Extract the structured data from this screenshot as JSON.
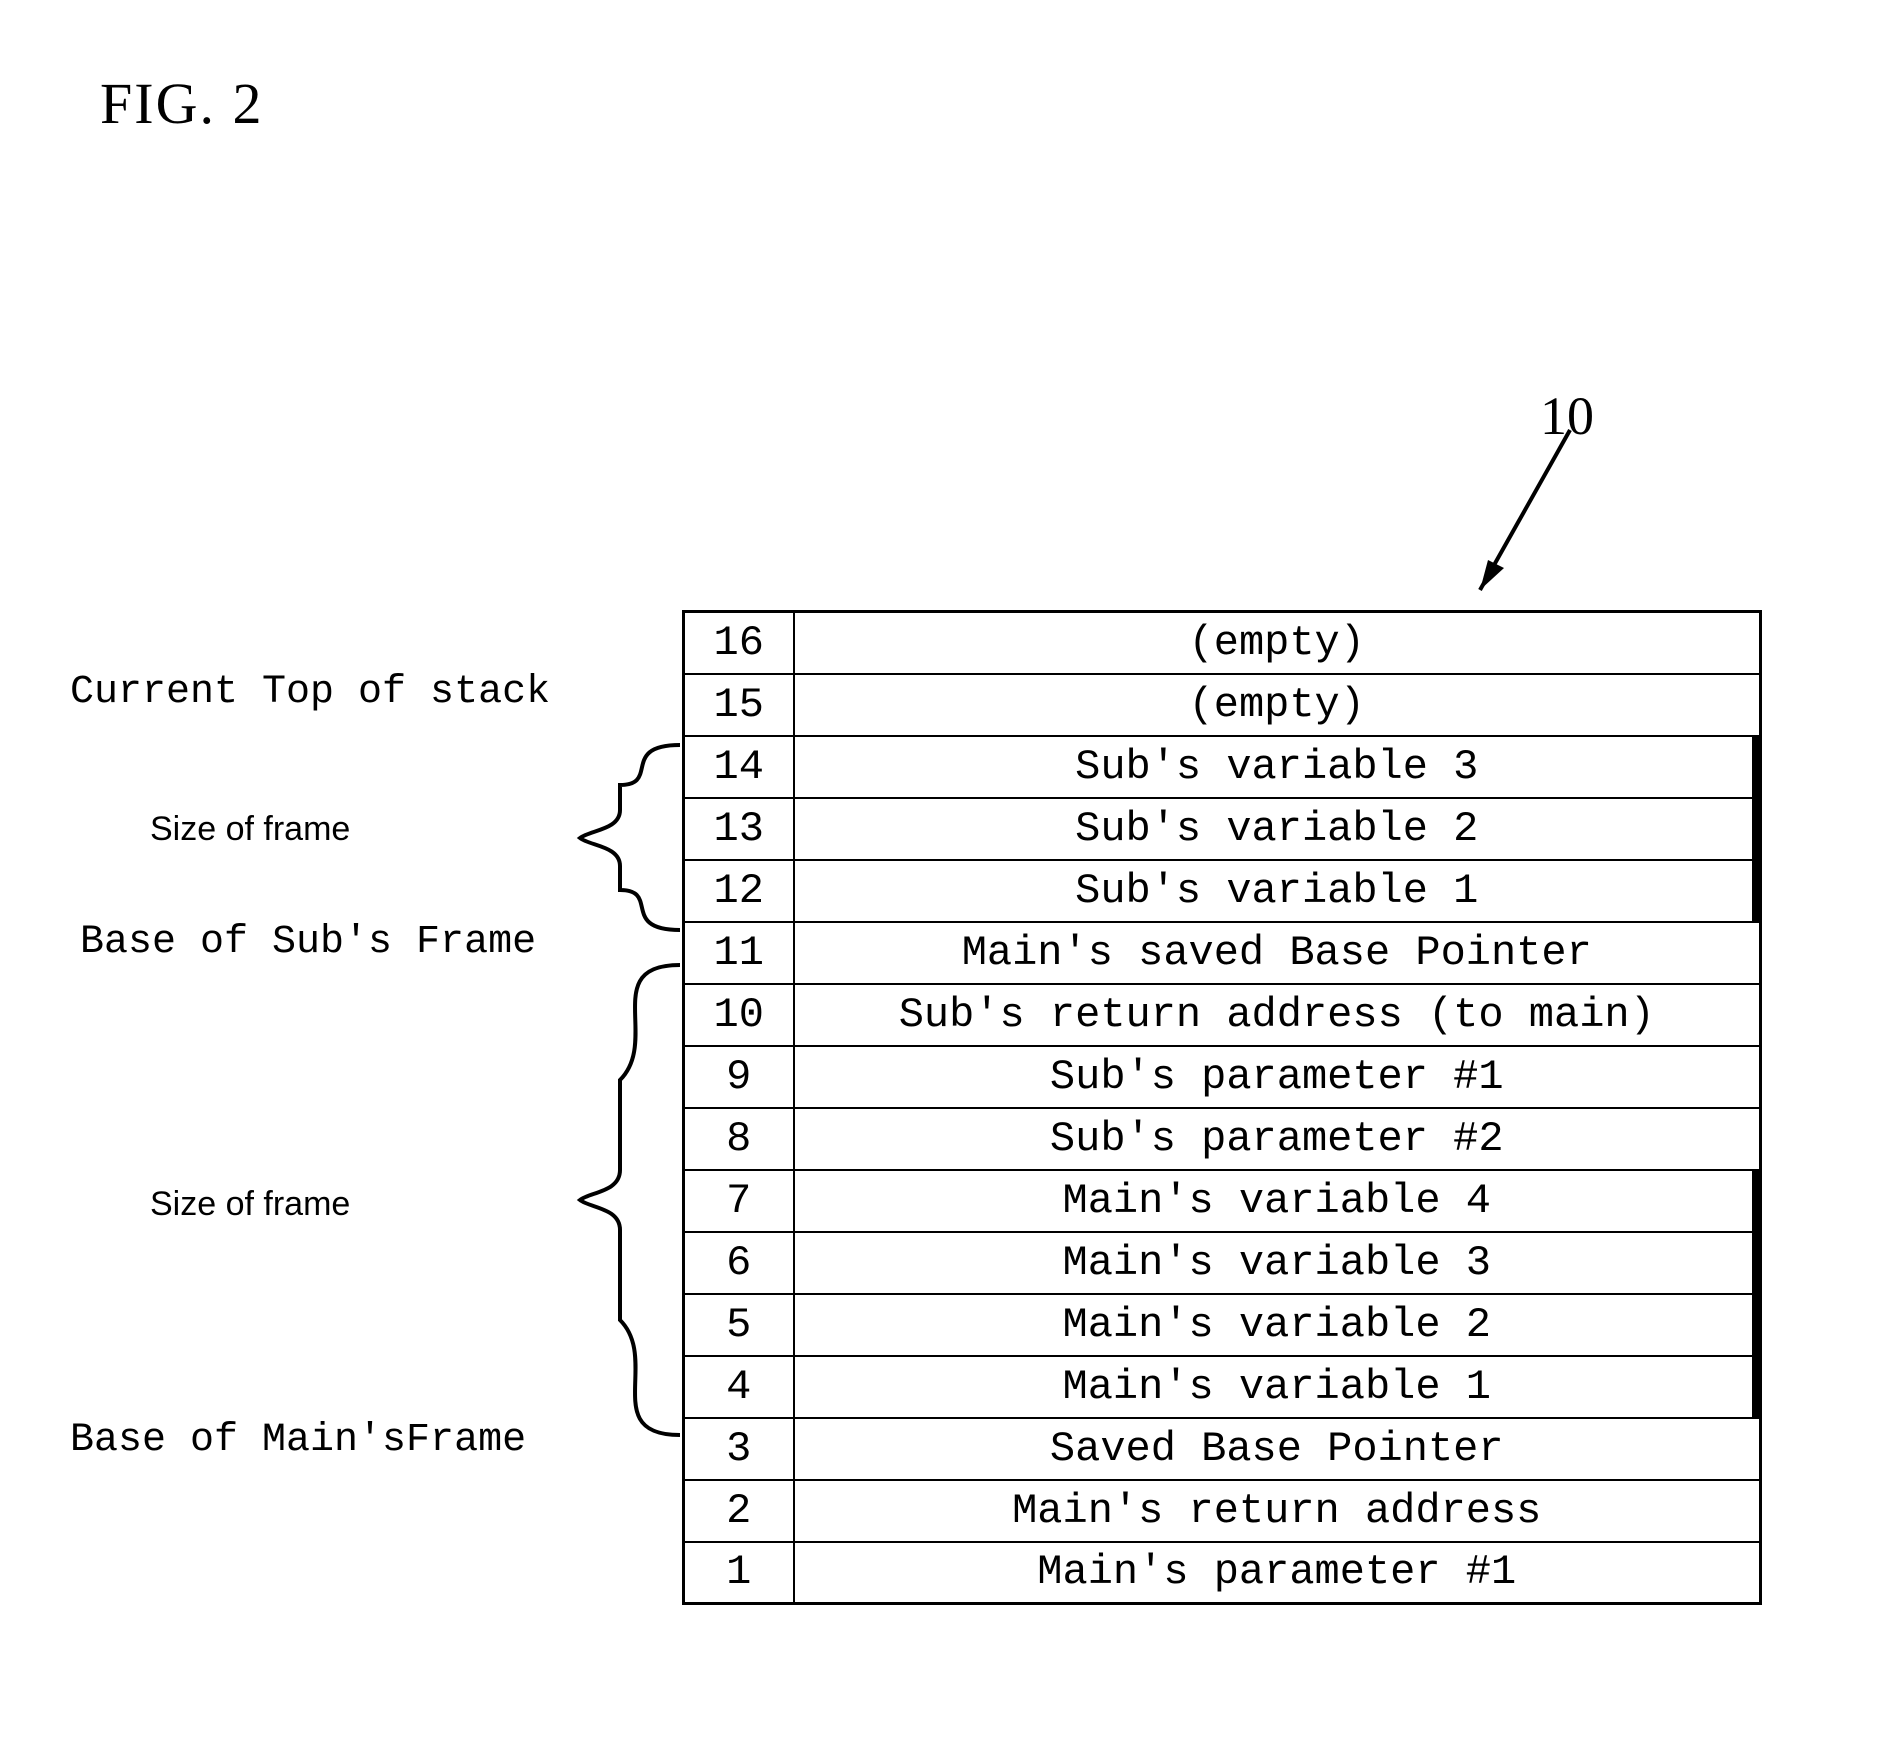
{
  "figure_title": "FIG. 2",
  "reference_number": "10",
  "labels": {
    "top_of_stack": "Current Top of stack",
    "size_of_frame_upper": "Size of frame",
    "base_sub": "Base of Sub's Frame",
    "size_of_frame_lower": "Size of frame",
    "base_main": "Base of Main'sFrame"
  },
  "rows": [
    {
      "addr": "16",
      "desc": "(empty)",
      "thick": false
    },
    {
      "addr": "15",
      "desc": "(empty)",
      "thick": false
    },
    {
      "addr": "14",
      "desc": "Sub's variable 3",
      "thick": true
    },
    {
      "addr": "13",
      "desc": "Sub's variable 2",
      "thick": true
    },
    {
      "addr": "12",
      "desc": "Sub's variable 1",
      "thick": true
    },
    {
      "addr": "11",
      "desc": "Main's saved Base Pointer",
      "thick": false
    },
    {
      "addr": "10",
      "desc": "Sub's return address (to main)",
      "thick": false
    },
    {
      "addr": "9",
      "desc": "Sub's parameter #1",
      "thick": false
    },
    {
      "addr": "8",
      "desc": "Sub's parameter #2",
      "thick": false
    },
    {
      "addr": "7",
      "desc": "Main's variable 4",
      "thick": true
    },
    {
      "addr": "6",
      "desc": "Main's variable 3",
      "thick": true
    },
    {
      "addr": "5",
      "desc": "Main's variable 2",
      "thick": true
    },
    {
      "addr": "4",
      "desc": "Main's variable 1",
      "thick": true
    },
    {
      "addr": "3",
      "desc": "Saved Base Pointer",
      "thick": false
    },
    {
      "addr": "2",
      "desc": "Main's return address",
      "thick": false
    },
    {
      "addr": "1",
      "desc": "Main's parameter #1",
      "thick": false
    }
  ]
}
